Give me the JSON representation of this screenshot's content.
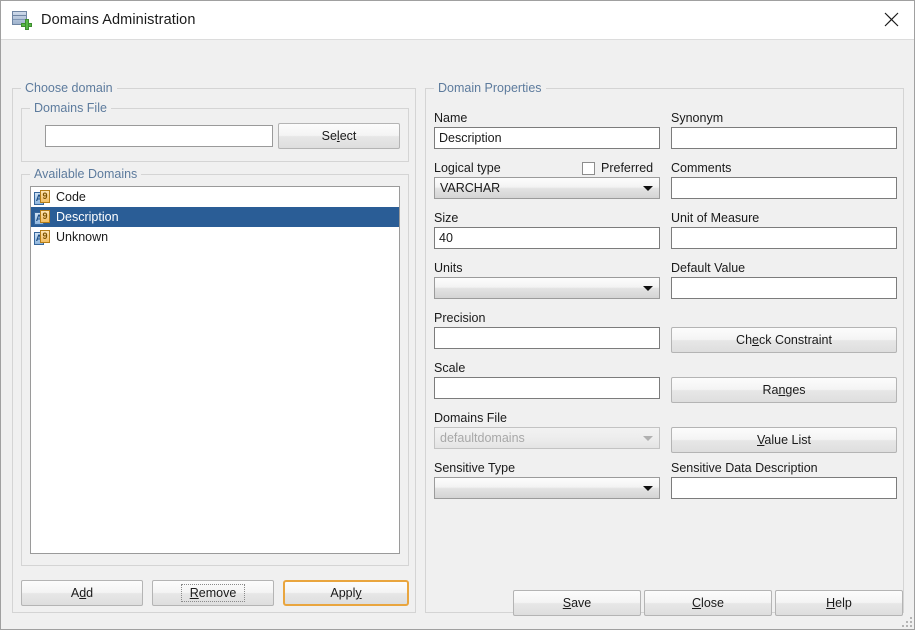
{
  "window": {
    "title": "Domains Administration",
    "app_icon": "domains-table-add-icon",
    "close_icon": "close-icon"
  },
  "choose_domain": {
    "legend": "Choose domain",
    "domains_file": {
      "legend": "Domains File",
      "path_value": "",
      "select_button": {
        "pre": "Se",
        "mnemonic": "l",
        "post": "ect"
      }
    },
    "available_domains": {
      "legend": "Available Domains",
      "items": [
        {
          "label": "Code",
          "icon": "alphanumeric-domain-icon",
          "selected": false
        },
        {
          "label": "Description",
          "icon": "alphanumeric-domain-icon",
          "selected": true
        },
        {
          "label": "Unknown",
          "icon": "alphanumeric-domain-icon",
          "selected": false
        }
      ]
    },
    "buttons": {
      "add": {
        "pre": "A",
        "mnemonic": "d",
        "post": "d"
      },
      "remove": {
        "pre": "",
        "mnemonic": "R",
        "post": "emove"
      },
      "apply": {
        "pre": "Appl",
        "mnemonic": "y",
        "post": ""
      }
    }
  },
  "domain_properties": {
    "legend": "Domain Properties",
    "fields": {
      "name_label": "Name",
      "name_value": "Description",
      "synonym_label": "Synonym",
      "synonym_value": "",
      "logical_type_label": "Logical type",
      "logical_type_value": "VARCHAR",
      "preferred_label": "Preferred",
      "preferred_checked": false,
      "comments_label": "Comments",
      "comments_value": "",
      "size_label": "Size",
      "size_value": "40",
      "unit_of_measure_label": "Unit of Measure",
      "unit_of_measure_value": "",
      "units_label": "Units",
      "units_value": "",
      "default_value_label": "Default Value",
      "default_value_value": "",
      "precision_label": "Precision",
      "precision_value": "",
      "scale_label": "Scale",
      "scale_value": "",
      "domains_file_label": "Domains File",
      "domains_file_value": "defaultdomains",
      "domains_file_disabled": true,
      "sensitive_type_label": "Sensitive Type",
      "sensitive_type_value": "",
      "sensitive_data_description_label": "Sensitive Data Description",
      "sensitive_data_description_value": ""
    },
    "buttons": {
      "check_constraint": {
        "pre": "Ch",
        "mnemonic": "e",
        "post": "ck Constraint"
      },
      "ranges": {
        "pre": "Ra",
        "mnemonic": "n",
        "post": "ges"
      },
      "value_list": {
        "pre": "",
        "mnemonic": "V",
        "post": "alue List"
      }
    }
  },
  "footer": {
    "save": {
      "pre": "",
      "mnemonic": "S",
      "post": "ave"
    },
    "close": {
      "pre": "",
      "mnemonic": "C",
      "post": "lose"
    },
    "help": {
      "pre": "",
      "mnemonic": "H",
      "post": "elp"
    }
  },
  "colors": {
    "window_background": "#f0f0f0",
    "titlebar_background": "#ffffff",
    "group_legend": "#5d7b9d",
    "selection": "#2a5d96",
    "focus_ring": "#e9a53e",
    "field_border": "#7c7c7c"
  }
}
